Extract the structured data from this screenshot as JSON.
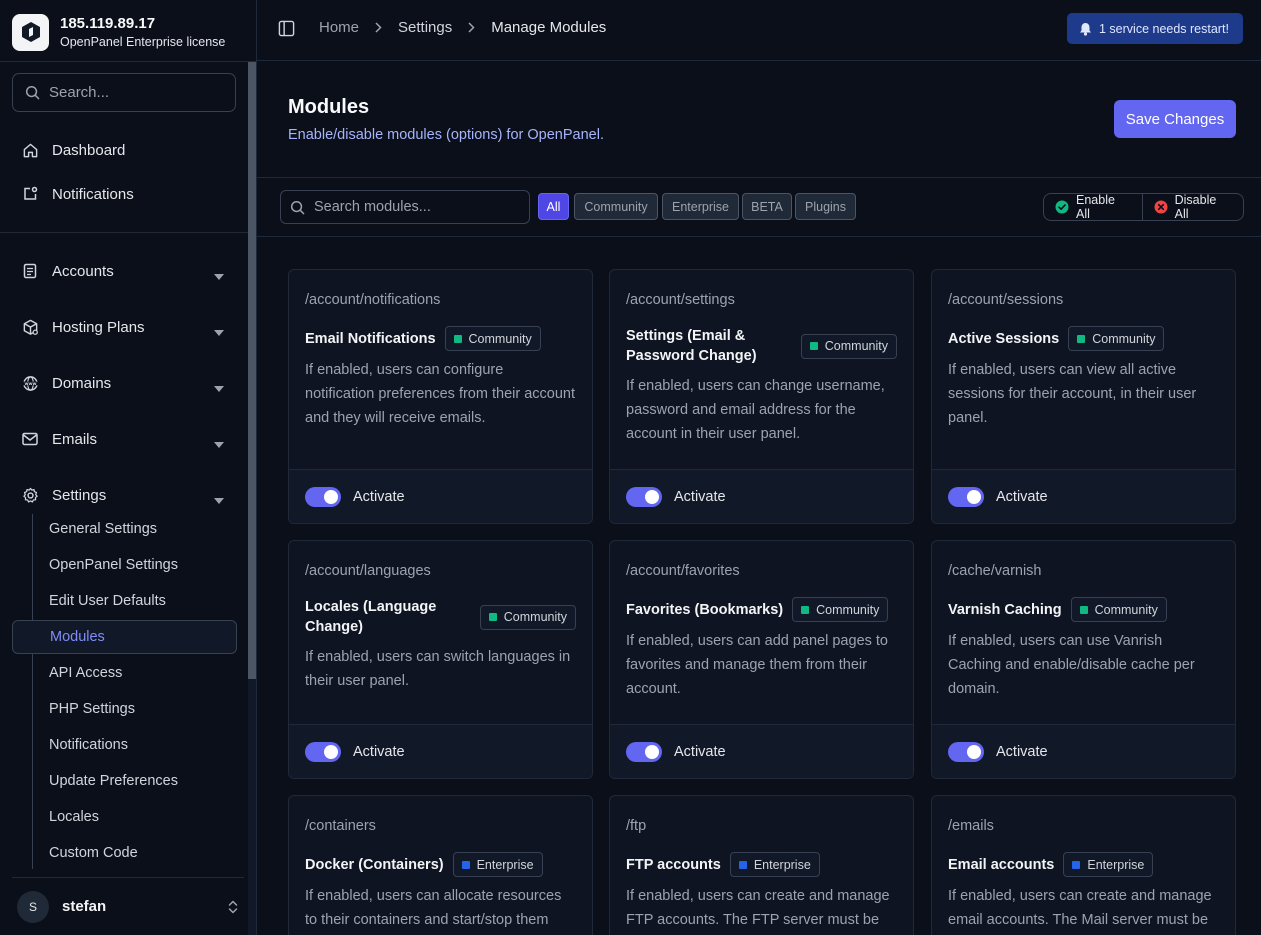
{
  "brand": {
    "ip": "185.119.89.17",
    "license": "OpenPanel Enterprise license"
  },
  "sidebar": {
    "search_placeholder": "Search...",
    "top_items": [
      {
        "label": "Dashboard"
      },
      {
        "label": "Notifications"
      }
    ],
    "groups": [
      {
        "label": "Accounts"
      },
      {
        "label": "Hosting Plans"
      },
      {
        "label": "Domains"
      },
      {
        "label": "Emails"
      },
      {
        "label": "Settings"
      }
    ],
    "settings_items": [
      {
        "label": "General Settings"
      },
      {
        "label": "OpenPanel Settings"
      },
      {
        "label": "Edit User Defaults"
      },
      {
        "label": "Modules"
      },
      {
        "label": "API Access"
      },
      {
        "label": "PHP Settings"
      },
      {
        "label": "Notifications"
      },
      {
        "label": "Update Preferences"
      },
      {
        "label": "Locales"
      },
      {
        "label": "Custom Code"
      }
    ],
    "user": {
      "initial": "S",
      "name": "stefan"
    }
  },
  "topbar": {
    "breadcrumbs": [
      "Home",
      "Settings",
      "Manage Modules"
    ],
    "restart_label": "1 service needs restart!"
  },
  "header": {
    "title": "Modules",
    "subtitle": "Enable/disable modules (options) for OpenPanel.",
    "save_label": "Save Changes"
  },
  "filters": {
    "search_placeholder": "Search modules...",
    "chips": [
      "All",
      "Community",
      "Enterprise",
      "BETA",
      "Plugins"
    ],
    "active_chip": "All",
    "enable_all": "Enable All",
    "disable_all": "Disable All"
  },
  "colors": {
    "accent": "#6366f1",
    "community": "#10b981",
    "enterprise": "#2563eb",
    "enable": "#10b981",
    "disable": "#ef4444"
  },
  "toggle_label": "Activate",
  "modules": [
    {
      "path": "/account/notifications",
      "title": "Email Notifications",
      "badge": "Community",
      "desc": "If enabled, users can configure notification preferences from their account and they will receive emails.",
      "enabled": true
    },
    {
      "path": "/account/settings",
      "title": "Settings (Email & Password Change)",
      "badge": "Community",
      "desc": "If enabled, users can change username, password and email address for the account in their user panel.",
      "enabled": true
    },
    {
      "path": "/account/sessions",
      "title": "Active Sessions",
      "badge": "Community",
      "desc": "If enabled, users can view all active sessions for their account, in their user panel.",
      "enabled": true
    },
    {
      "path": "/account/languages",
      "title": "Locales (Language Change)",
      "badge": "Community",
      "desc": "If enabled, users can switch languages in their user panel.",
      "enabled": true
    },
    {
      "path": "/account/favorites",
      "title": "Favorites (Bookmarks)",
      "badge": "Community",
      "desc": "If enabled, users can add panel pages to favorites and manage them from their account.",
      "enabled": true
    },
    {
      "path": "/cache/varnish",
      "title": "Varnish Caching",
      "badge": "Community",
      "desc": "If enabled, users can use Vanrish Caching and enable/disable cache per domain.",
      "enabled": true
    },
    {
      "path": "/containers",
      "title": "Docker (Containers)",
      "badge": "Enterprise",
      "desc": "If enabled, users can allocate resources to their containers and start/stop them",
      "enabled": true
    },
    {
      "path": "/ftp",
      "title": "FTP accounts",
      "badge": "Enterprise",
      "desc": "If enabled, users can create and manage FTP accounts. The FTP server must be",
      "enabled": true
    },
    {
      "path": "/emails",
      "title": "Email accounts",
      "badge": "Enterprise",
      "desc": "If enabled, users can create and manage email accounts. The Mail server must be",
      "enabled": true
    }
  ]
}
